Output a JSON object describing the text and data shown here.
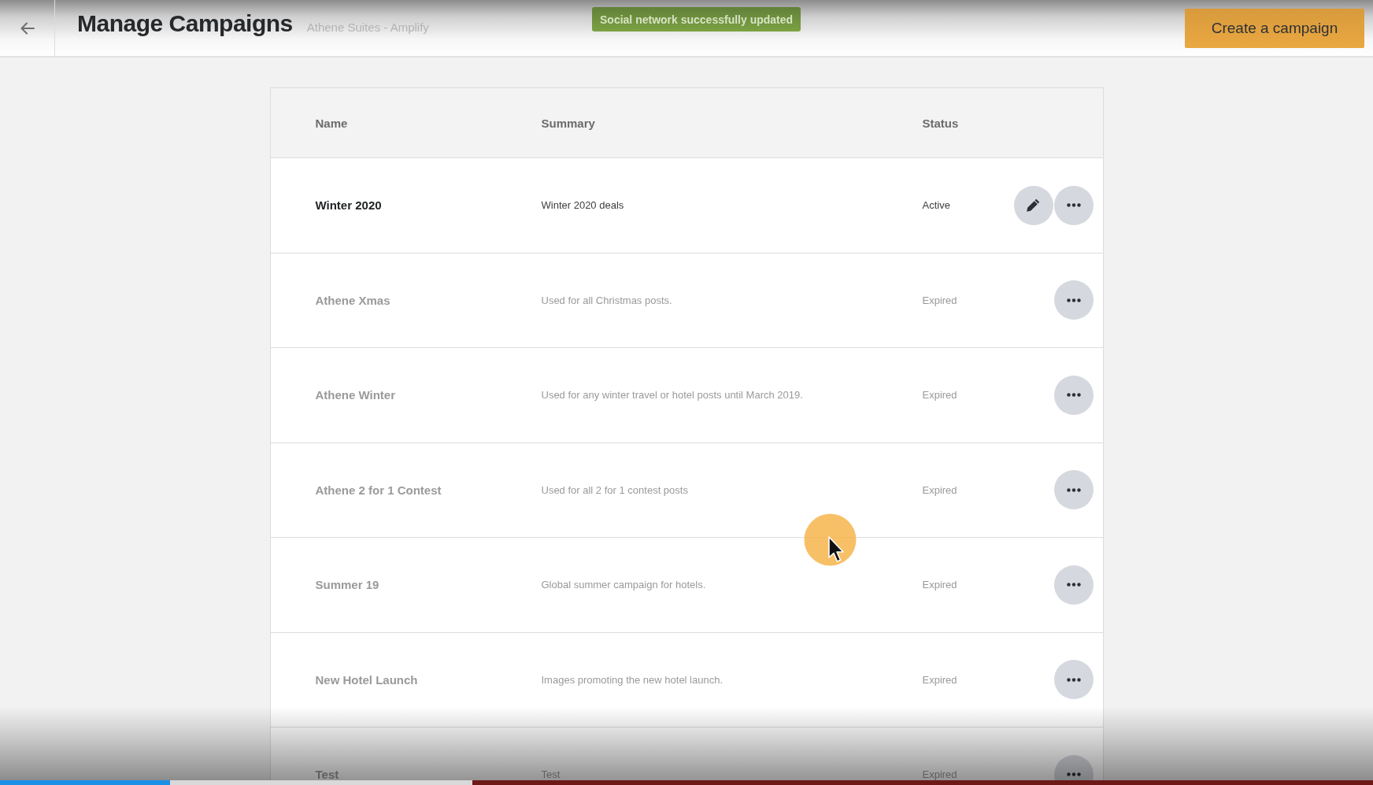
{
  "header": {
    "title": "Manage Campaigns",
    "subtitle": "Athene Suites - Amplify"
  },
  "toast": {
    "text": "Social network successfully updated"
  },
  "create_button": {
    "label": "Create a campaign"
  },
  "table": {
    "columns": [
      "Name",
      "Summary",
      "Status"
    ],
    "rows": [
      {
        "name": "Winter 2020",
        "summary": "Winter 2020 deals",
        "status": "Active",
        "active": true,
        "actions": [
          {
            "kind": "edit"
          },
          {
            "kind": "more"
          }
        ]
      },
      {
        "name": "Athene Xmas",
        "summary": "Used for all Christmas posts.",
        "status": "Expired",
        "active": false,
        "actions": [
          {
            "kind": "more"
          }
        ]
      },
      {
        "name": "Athene Winter",
        "summary": "Used for any winter travel or hotel posts until March 2019.",
        "status": "Expired",
        "active": false,
        "actions": [
          {
            "kind": "more"
          }
        ]
      },
      {
        "name": "Athene 2 for 1 Contest",
        "summary": "Used for all 2 for 1 contest posts",
        "status": "Expired",
        "active": false,
        "actions": [
          {
            "kind": "more"
          }
        ]
      },
      {
        "name": "Summer 19",
        "summary": "Global summer campaign for hotels.",
        "status": "Expired",
        "active": false,
        "actions": [
          {
            "kind": "more"
          }
        ]
      },
      {
        "name": "New Hotel Launch",
        "summary": "Images promoting the new hotel launch.",
        "status": "Expired",
        "active": false,
        "actions": [
          {
            "kind": "more"
          }
        ]
      },
      {
        "name": "Test",
        "summary": "Test",
        "status": "Expired",
        "active": false,
        "actions": [
          {
            "kind": "more"
          }
        ]
      }
    ]
  },
  "video_player": {
    "progress": {
      "level": 0.124
    },
    "buffered": {
      "level": 0.344
    }
  }
}
